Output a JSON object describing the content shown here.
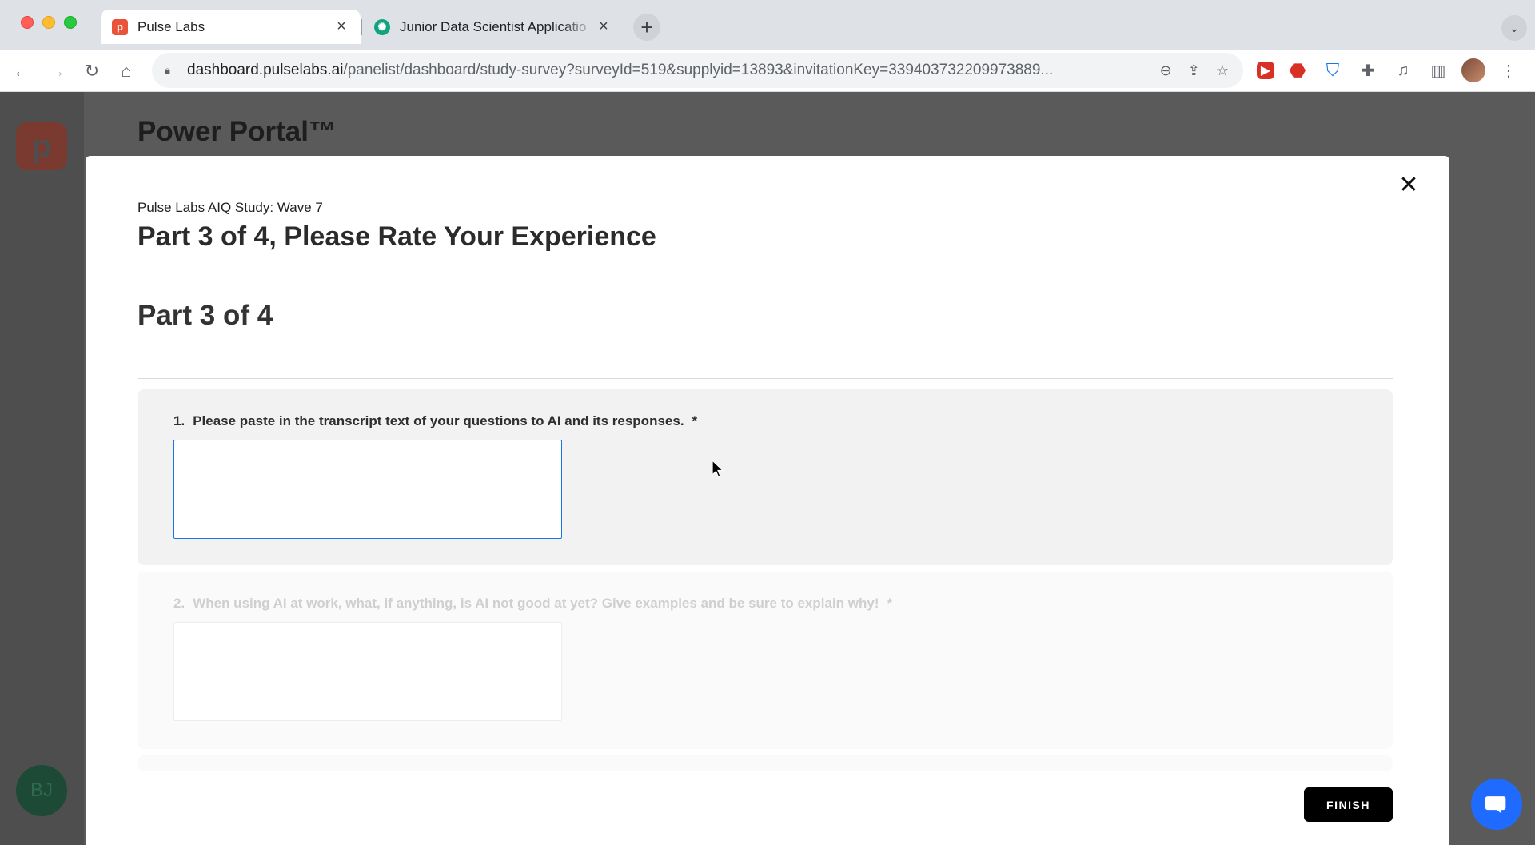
{
  "browser": {
    "tabs": [
      {
        "title": "Pulse Labs",
        "active": true,
        "favicon": "pulse-labs-logo"
      },
      {
        "title": "Junior Data Scientist Applicatio",
        "active": false,
        "favicon": "chatgpt-logo"
      }
    ],
    "url_host": "dashboard.pulselabs.ai",
    "url_path": "/panelist/dashboard/study-survey?surveyId=519&supplyid=13893&invitationKey=339403732209973889..."
  },
  "page": {
    "title": "Power Portal™",
    "avatar_initials": "BJ"
  },
  "modal": {
    "study_name": "Pulse Labs AIQ Study: Wave 7",
    "heading": "Part 3 of 4, Please Rate Your Experience",
    "section_title": "Part 3 of 4",
    "questions": [
      {
        "number": "1.",
        "text": "Please paste in the transcript text of your questions to AI and its responses.",
        "required_mark": "*",
        "value": ""
      },
      {
        "number": "2.",
        "text": "When using AI at work, what, if anything, is AI not good at yet? Give examples and be sure to explain why!",
        "required_mark": "*",
        "value": ""
      }
    ],
    "finish_label": "FINISH"
  },
  "colors": {
    "accent": "#1a73e8",
    "finish_bg": "#000000",
    "chat_bubble": "#1f6bff"
  }
}
